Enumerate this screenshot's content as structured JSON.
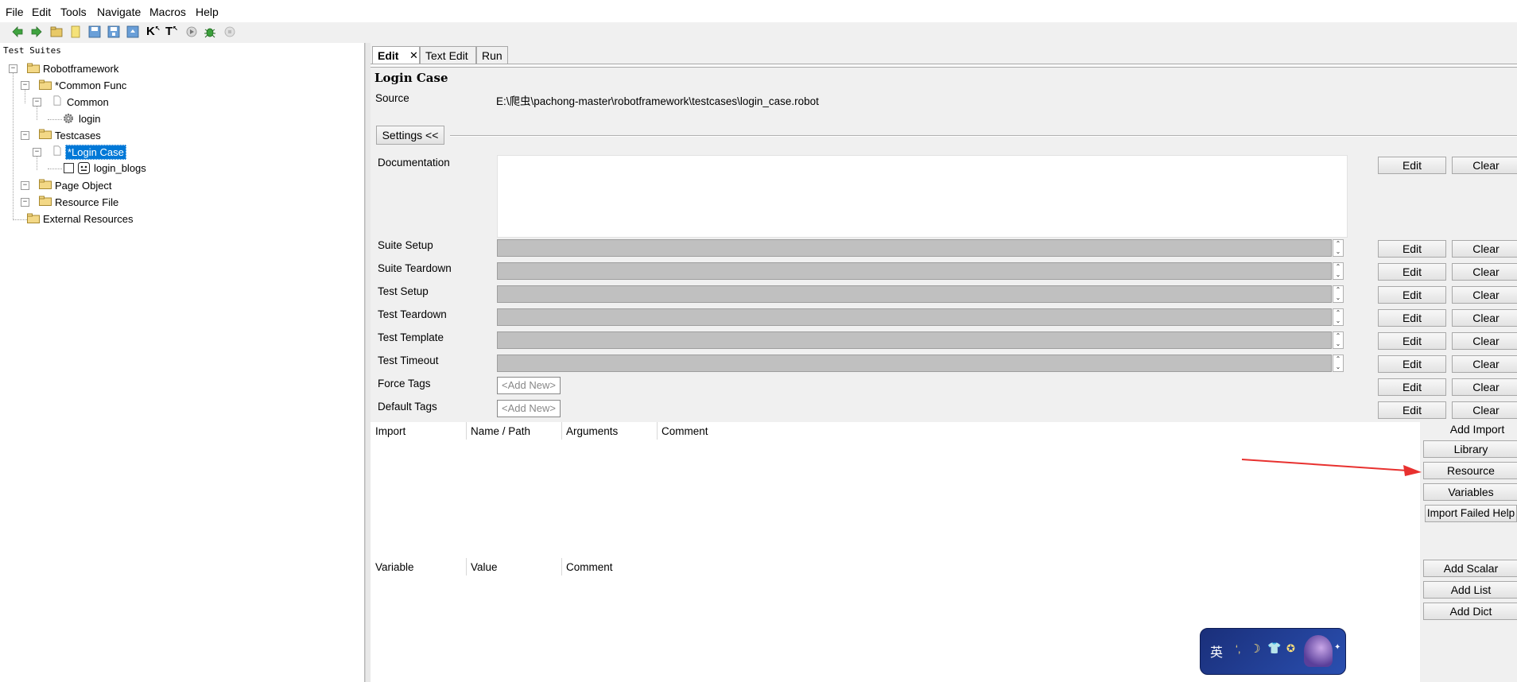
{
  "menu": [
    "File",
    "Edit",
    "Tools",
    "Navigate",
    "Macros",
    "Help"
  ],
  "toolbar": {
    "icons": [
      "back-arrow-icon",
      "forward-arrow-icon",
      "open-folder-icon",
      "new-file-icon",
      "save-icon",
      "save-all-icon",
      "export-icon",
      "search-keyword-icon",
      "search-text-icon",
      "run-icon",
      "debug-bug-icon",
      "stop-icon"
    ],
    "k_label": "K",
    "t_label": "T"
  },
  "tree": {
    "title": "Test Suites",
    "nodes": {
      "robotframework": "Robotframework",
      "common_func": "*Common Func",
      "common": "Common",
      "login": "login",
      "testcases": "Testcases",
      "login_case": "*Login Case",
      "login_blogs": "login_blogs",
      "page_object": "Page Object",
      "resource_file": "Resource File",
      "external_resources": "External Resources"
    }
  },
  "tabs": [
    "Edit",
    "Text Edit",
    "Run"
  ],
  "editor": {
    "title": "Login Case",
    "source_label": "Source",
    "source_path": "E:\\爬虫\\pachong-master\\robotframework\\testcases\\login_case.robot",
    "settings_button": "Settings <<",
    "documentation_label": "Documentation",
    "rows": [
      "Suite Setup",
      "Suite Teardown",
      "Test Setup",
      "Test Teardown",
      "Test Template",
      "Test Timeout"
    ],
    "force_tags_label": "Force Tags",
    "default_tags_label": "Default Tags",
    "add_new": "<Add New>",
    "edit_label": "Edit",
    "clear_label": "Clear"
  },
  "imports": {
    "headers": [
      "Import",
      "Name / Path",
      "Arguments",
      "Comment"
    ],
    "add_import": "Add Import",
    "library": "Library",
    "resource": "Resource",
    "variables": "Variables",
    "import_failed_help": "Import Failed Help"
  },
  "variables_table": {
    "headers": [
      "Variable",
      "Value",
      "Comment"
    ],
    "add_scalar": "Add Scalar",
    "add_list": "Add List",
    "add_dict": "Add Dict"
  },
  "ime": {
    "label": "英"
  },
  "colors": {
    "selection": "#0078d7",
    "annotation_arrow": "#e8312f",
    "ime_background": "#1c3a8a"
  }
}
